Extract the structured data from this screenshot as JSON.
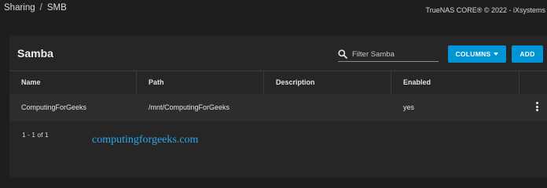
{
  "topbar": {
    "breadcrumb": [
      "Sharing",
      "SMB"
    ],
    "separator": "/",
    "copyright": "TrueNAS CORE® © 2022 - iXsystems"
  },
  "card": {
    "title": "Samba",
    "search": {
      "placeholder": "Filter Samba",
      "value": "",
      "icon": "search-icon"
    },
    "buttons": {
      "columns": "COLUMNS",
      "add": "ADD"
    },
    "accent_color": "#0095d5",
    "table": {
      "columns": [
        "Name",
        "Path",
        "Description",
        "Enabled"
      ],
      "rows": [
        {
          "name": "ComputingForGeeks",
          "path": "/mnt/ComputingForGeeks",
          "description": "",
          "enabled": "yes"
        }
      ]
    },
    "paginator": "1 - 1 of 1"
  },
  "watermark": "computingforgeeks.com"
}
